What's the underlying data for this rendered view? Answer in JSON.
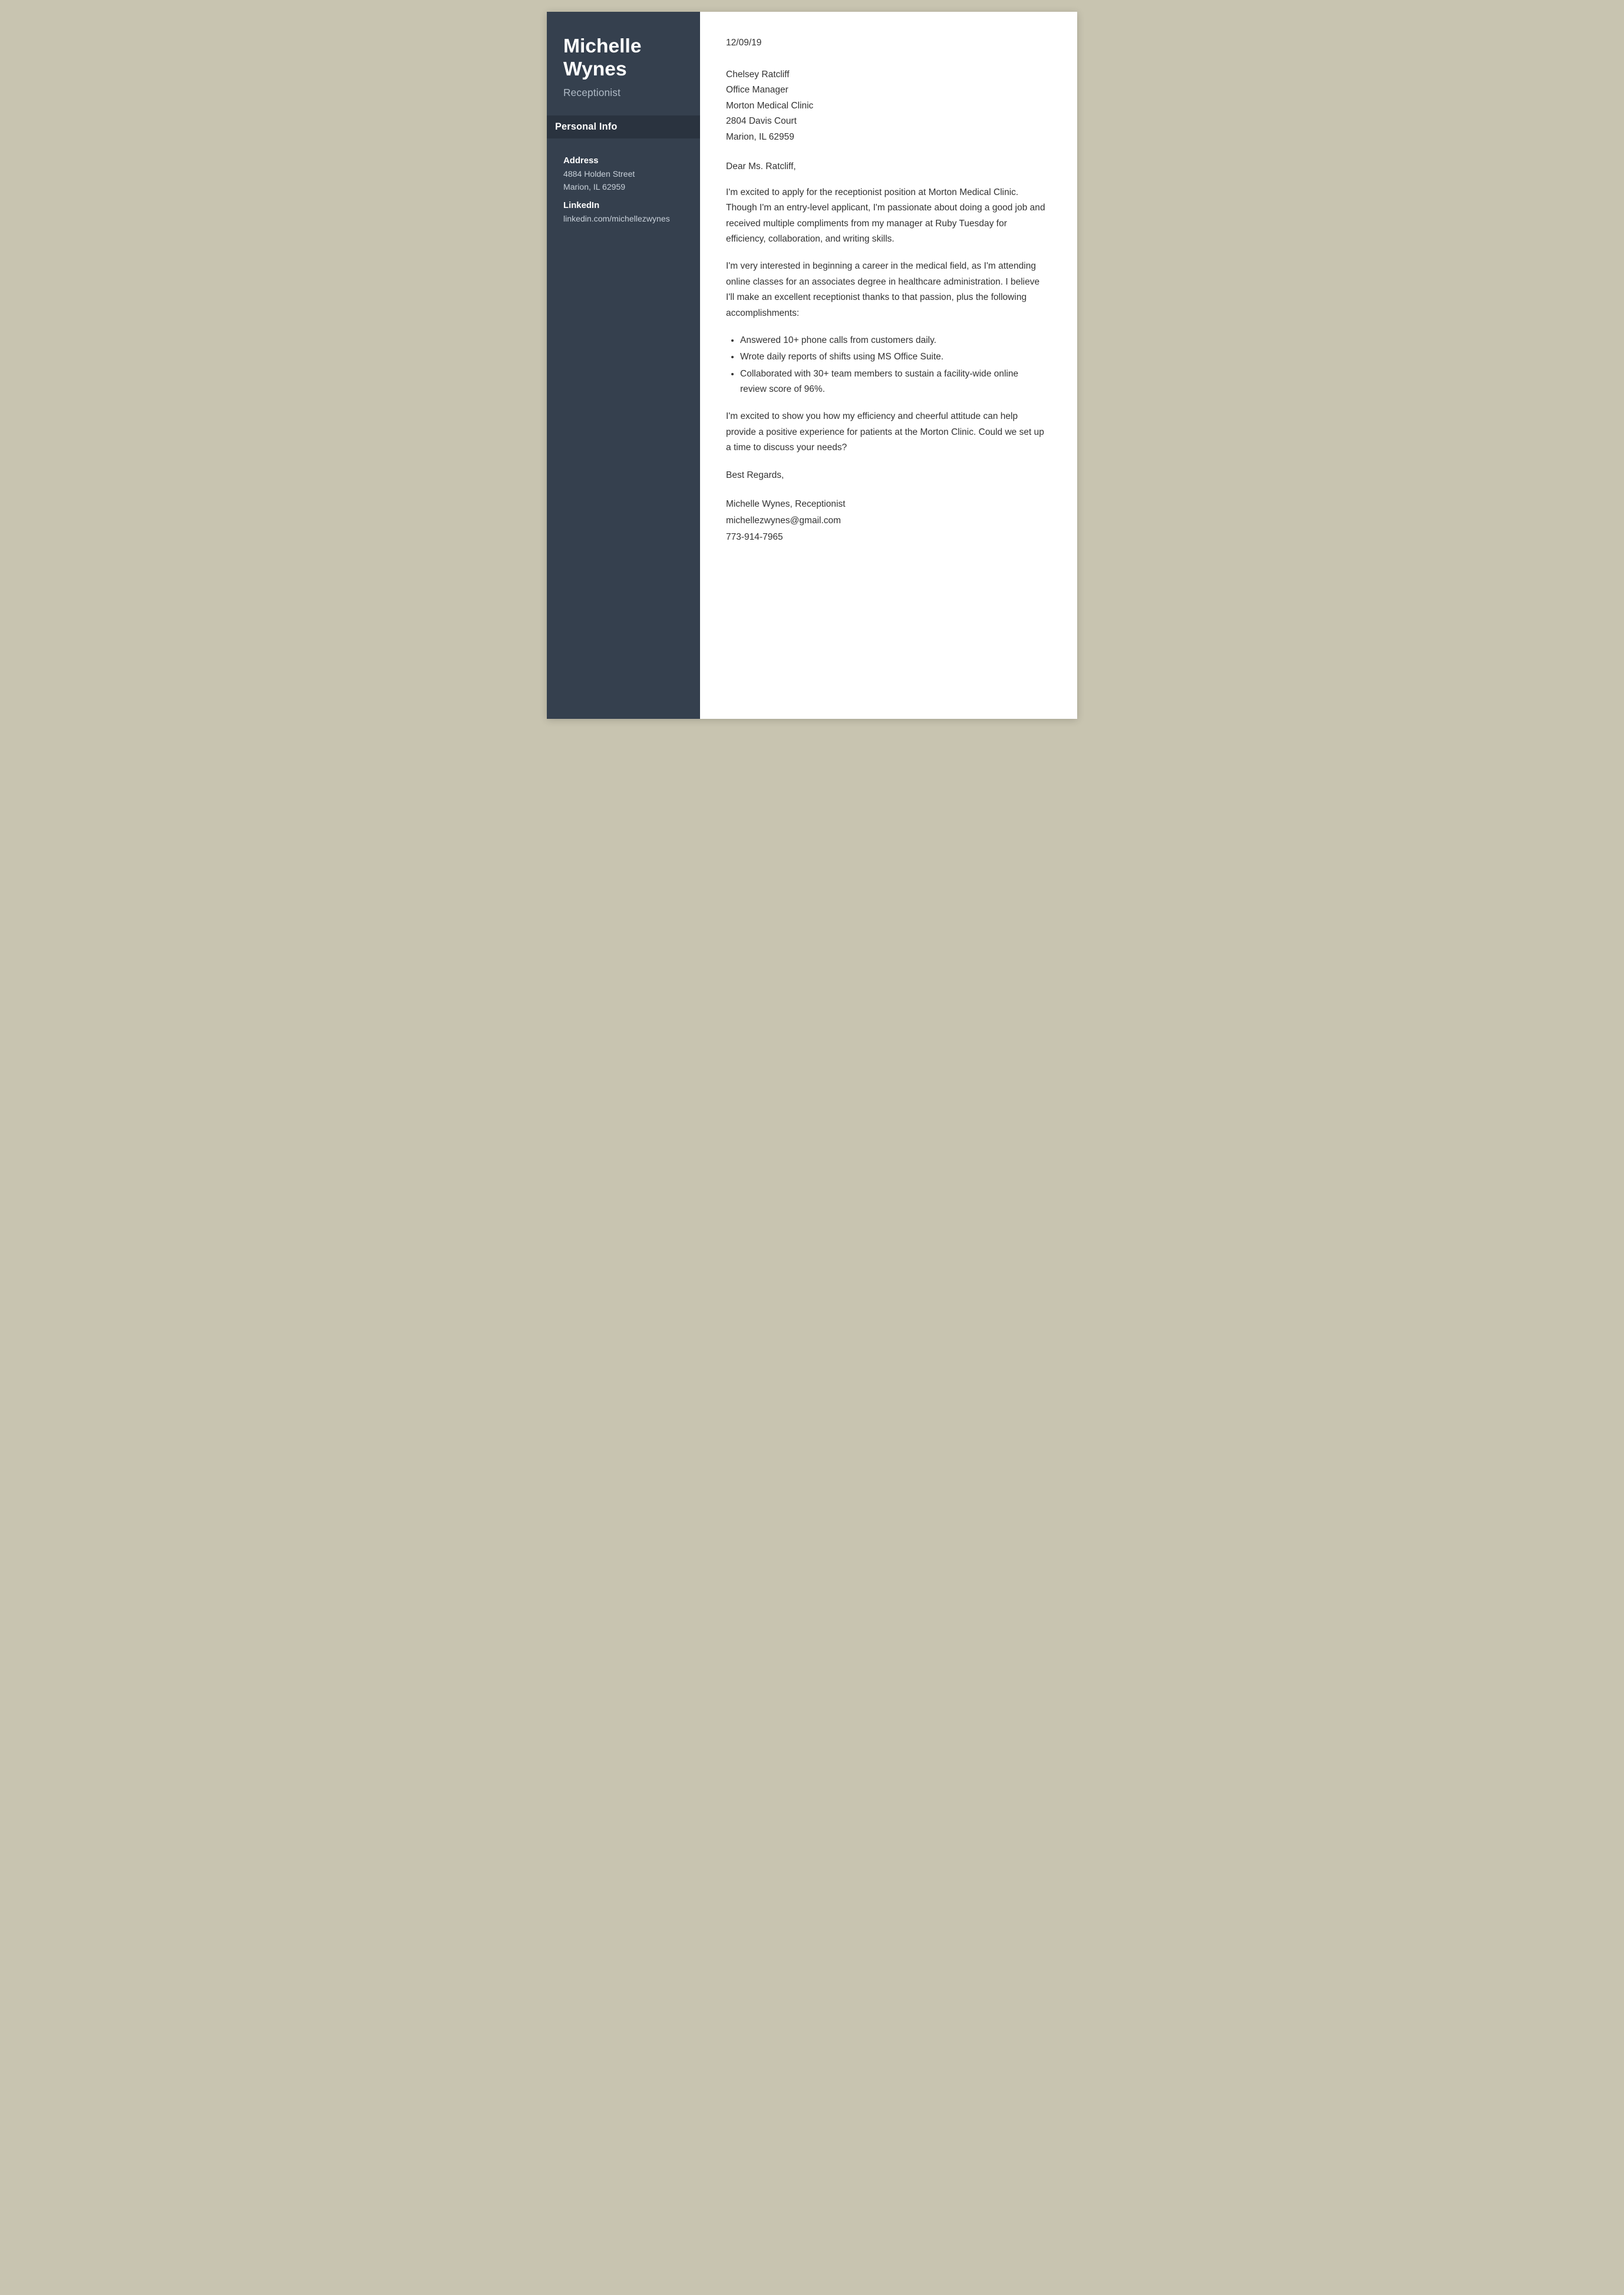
{
  "sidebar": {
    "name": "Michelle Wynes",
    "title": "Receptionist",
    "personal_info_header": "Personal Info",
    "address_label": "Address",
    "address_line1": "4884 Holden Street",
    "address_line2": "Marion, IL 62959",
    "linkedin_label": "LinkedIn",
    "linkedin_value": "linkedin.com/michellezwynes"
  },
  "letter": {
    "date": "12/09/19",
    "recipient_name": "Chelsey Ratcliff",
    "recipient_title": "Office Manager",
    "recipient_company": "Morton Medical Clinic",
    "recipient_address": "2804 Davis Court",
    "recipient_city": "Marion, IL 62959",
    "salutation": "Dear Ms. Ratcliff,",
    "paragraph1": "I'm excited to apply for the receptionist position at Morton Medical Clinic. Though I'm an entry-level applicant, I'm passionate about doing a good job and received multiple compliments from my manager at Ruby Tuesday for efficiency, collaboration, and writing skills.",
    "paragraph2": "I'm very interested in beginning a career in the medical field, as I'm attending online classes for an associates degree in healthcare administration. I believe I'll make an excellent receptionist thanks to that passion, plus the following accomplishments:",
    "bullets": [
      "Answered 10+ phone calls from customers daily.",
      "Wrote daily reports of shifts using MS Office Suite.",
      "Collaborated with 30+ team members to sustain a facility-wide online review score of 96%."
    ],
    "paragraph3": "I'm excited to show you how my efficiency and cheerful attitude can help provide a positive experience for patients at the Morton Clinic. Could we set up a time to discuss your needs?",
    "closing": "Best Regards,",
    "signature_name": "Michelle Wynes, Receptionist",
    "signature_email": "michellezwynes@gmail.com",
    "signature_phone": "773-914-7965"
  }
}
